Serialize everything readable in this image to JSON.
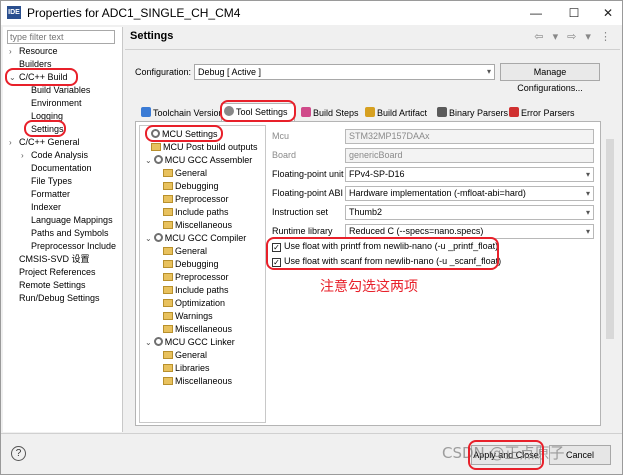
{
  "window": {
    "title": "Properties for ADC1_SINGLE_CH_CM4",
    "app_icon_label": "IDE",
    "minimize_glyph": "—",
    "maximize_glyph": "☐",
    "close_glyph": "✕"
  },
  "left_panel": {
    "filter_placeholder": "type filter text",
    "items": [
      {
        "label": "Resource",
        "arrow": "›"
      },
      {
        "label": "Builders",
        "arrow": ""
      },
      {
        "label": "C/C++ Build",
        "arrow": "⌄"
      },
      {
        "label": "Build Variables",
        "arrow": ""
      },
      {
        "label": "Environment",
        "arrow": ""
      },
      {
        "label": "Logging",
        "arrow": ""
      },
      {
        "label": "Settings",
        "arrow": ""
      },
      {
        "label": "C/C++ General",
        "arrow": "›"
      },
      {
        "label": "Code Analysis",
        "arrow": "›"
      },
      {
        "label": "Documentation",
        "arrow": ""
      },
      {
        "label": "File Types",
        "arrow": ""
      },
      {
        "label": "Formatter",
        "arrow": ""
      },
      {
        "label": "Indexer",
        "arrow": ""
      },
      {
        "label": "Language Mappings",
        "arrow": ""
      },
      {
        "label": "Paths and Symbols",
        "arrow": ""
      },
      {
        "label": "Preprocessor Include",
        "arrow": ""
      },
      {
        "label": "CMSIS-SVD 设置",
        "arrow": ""
      },
      {
        "label": "Project References",
        "arrow": ""
      },
      {
        "label": "Remote Settings",
        "arrow": ""
      },
      {
        "label": "Run/Debug Settings",
        "arrow": ""
      }
    ]
  },
  "header": {
    "title": "Settings",
    "nav_icons": "⇦ ▾ ⇨ ▾ ⋮"
  },
  "configuration": {
    "label": "Configuration:",
    "value": "Debug  [ Active ]",
    "manage_button": "Manage Configurations..."
  },
  "tabs": [
    {
      "label": "Toolchain Version",
      "icon": "toolchain-icon",
      "active": false
    },
    {
      "label": "Tool Settings",
      "icon": "gear-icon",
      "active": true
    },
    {
      "label": "Build Steps",
      "icon": "build-steps-icon",
      "active": false
    },
    {
      "label": "Build Artifact",
      "icon": "artifact-icon",
      "active": false
    },
    {
      "label": "Binary Parsers",
      "icon": "binary-icon",
      "active": false
    },
    {
      "label": "Error Parsers",
      "icon": "error-icon",
      "active": false
    }
  ],
  "tool_tree": [
    {
      "label": "MCU Settings",
      "icon": "gear"
    },
    {
      "label": "MCU Post build outputs",
      "icon": "folder"
    },
    {
      "label": "MCU GCC Assembler",
      "icon": "gear"
    },
    {
      "label": "General",
      "icon": "folder"
    },
    {
      "label": "Debugging",
      "icon": "folder"
    },
    {
      "label": "Preprocessor",
      "icon": "folder"
    },
    {
      "label": "Include paths",
      "icon": "folder"
    },
    {
      "label": "Miscellaneous",
      "icon": "folder"
    },
    {
      "label": "MCU GCC Compiler",
      "icon": "gear"
    },
    {
      "label": "General",
      "icon": "folder"
    },
    {
      "label": "Debugging",
      "icon": "folder"
    },
    {
      "label": "Preprocessor",
      "icon": "folder"
    },
    {
      "label": "Include paths",
      "icon": "folder"
    },
    {
      "label": "Optimization",
      "icon": "folder"
    },
    {
      "label": "Warnings",
      "icon": "folder"
    },
    {
      "label": "Miscellaneous",
      "icon": "folder"
    },
    {
      "label": "MCU GCC Linker",
      "icon": "gear"
    },
    {
      "label": "General",
      "icon": "folder"
    },
    {
      "label": "Libraries",
      "icon": "folder"
    },
    {
      "label": "Miscellaneous",
      "icon": "folder"
    }
  ],
  "fields": [
    {
      "label": "Mcu",
      "value": "STM32MP157DAAx"
    },
    {
      "label": "Board",
      "value": "genericBoard"
    },
    {
      "label": "Floating-point unit",
      "value": "FPv4-SP-D16"
    },
    {
      "label": "Floating-point ABI",
      "value": "Hardware implementation (-mfloat-abi=hard)"
    },
    {
      "label": "Instruction set",
      "value": "Thumb2"
    },
    {
      "label": "Runtime library",
      "value": "Reduced C (--specs=nano.specs)"
    }
  ],
  "checkboxes": [
    {
      "label": "Use float with printf from newlib-nano (-u _printf_float)",
      "mark": "✓"
    },
    {
      "label": "Use float with scanf from newlib-nano (-u _scanf_float)",
      "mark": "✓"
    }
  ],
  "annotation": "注意勾选这两项",
  "footer": {
    "help_glyph": "?",
    "apply_close": "Apply and Close",
    "cancel": "Cancel",
    "watermark": "CSDN @正点原子"
  },
  "colors": {
    "highlight": "#e8202a",
    "folder": "#e8c15d"
  }
}
